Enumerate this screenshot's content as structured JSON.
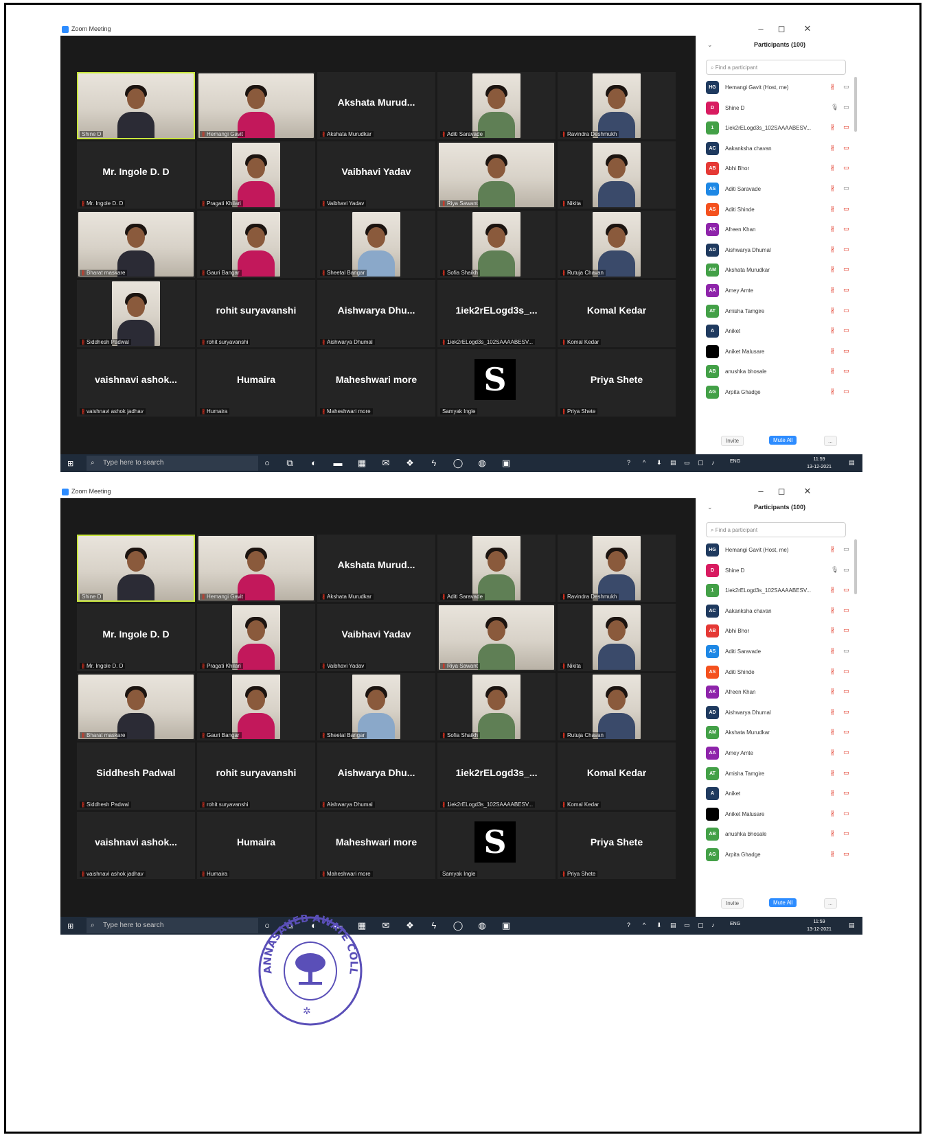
{
  "window_title": "Zoom Meeting",
  "panel": {
    "title": "Participants (100)",
    "search_placeholder": "Find a participant",
    "invite_label": "Invite",
    "mute_all_label": "Mute All",
    "more_label": "..."
  },
  "taskbar": {
    "search_placeholder": "Type here to search",
    "lang": "ENG",
    "time": "11:59",
    "date": "13-12-2021"
  },
  "screens": [
    {
      "tiles": [
        {
          "caption": "Shine D",
          "big": "",
          "photo": "wide",
          "mic": false,
          "active": true
        },
        {
          "caption": "Hemangi Gavit",
          "big": "",
          "photo": "wide",
          "mic": true
        },
        {
          "caption": "Akshata Murudkar",
          "big": "Akshata Murud...",
          "mic": true
        },
        {
          "caption": "Aditi Saravade",
          "big": "",
          "photo": "narrow",
          "mic": true
        },
        {
          "caption": "Ravindra Deshmukh",
          "big": "",
          "photo": "narrow",
          "mic": true
        },
        {
          "caption": "Mr. Ingole D. D",
          "big": "Mr. Ingole D. D",
          "mic": true
        },
        {
          "caption": "Pragati Khilari",
          "big": "",
          "photo": "narrow",
          "mic": true
        },
        {
          "caption": "Vaibhavi Yadav",
          "big": "Vaibhavi Yadav",
          "mic": true
        },
        {
          "caption": "Riya Sawant",
          "big": "",
          "photo": "wide",
          "mic": true
        },
        {
          "caption": "Nikita",
          "big": "",
          "photo": "narrow",
          "mic": true
        },
        {
          "caption": "Bharat maskare",
          "big": "",
          "photo": "wide",
          "mic": true
        },
        {
          "caption": "Gauri Bangar",
          "big": "",
          "photo": "narrow",
          "mic": true
        },
        {
          "caption": "Sheetal Bangar",
          "big": "",
          "photo": "narrow",
          "mic": true
        },
        {
          "caption": "Sofia Shaikh",
          "big": "",
          "photo": "narrow",
          "mic": true
        },
        {
          "caption": "Rutuja Chavan",
          "big": "",
          "photo": "narrow",
          "mic": true
        },
        {
          "caption": "Siddhesh Padwal",
          "big": "",
          "photo": "narrow",
          "mic": true
        },
        {
          "caption": "rohit suryavanshi",
          "big": "rohit suryavanshi",
          "mic": true
        },
        {
          "caption": "Aishwarya Dhumal",
          "big": "Aishwarya  Dhu...",
          "mic": true
        },
        {
          "caption": "1iek2rELogd3s_102SAAAABESV...",
          "big": "1iek2rELogd3s_...",
          "mic": true
        },
        {
          "caption": "Komal Kedar",
          "big": "Komal Kedar",
          "mic": true
        },
        {
          "caption": "vaishnavi ashok jadhav",
          "big": "vaishnavi  ashok...",
          "mic": true
        },
        {
          "caption": "Humaira",
          "big": "Humaira",
          "mic": true
        },
        {
          "caption": "Maheshwari more",
          "big": "Maheshwari more",
          "mic": true
        },
        {
          "caption": "Samyak Ingle",
          "big": "",
          "logo": "S",
          "mic": false
        },
        {
          "caption": "Priya Shete",
          "big": "Priya Shete",
          "mic": true
        }
      ]
    },
    {
      "tiles": [
        {
          "caption": "Shine D",
          "big": "",
          "photo": "wide",
          "mic": false,
          "active": true
        },
        {
          "caption": "Hemangi Gavit",
          "big": "",
          "photo": "wide",
          "mic": true
        },
        {
          "caption": "Akshata Murudkar",
          "big": "Akshata Murud...",
          "mic": true
        },
        {
          "caption": "Aditi Saravade",
          "big": "",
          "photo": "narrow",
          "mic": true
        },
        {
          "caption": "Ravindra Deshmukh",
          "big": "",
          "photo": "narrow",
          "mic": true
        },
        {
          "caption": "Mr. Ingole D. D",
          "big": "Mr. Ingole D. D",
          "mic": true
        },
        {
          "caption": "Pragati Khilari",
          "big": "",
          "photo": "narrow",
          "mic": true
        },
        {
          "caption": "Vaibhavi Yadav",
          "big": "Vaibhavi Yadav",
          "mic": true
        },
        {
          "caption": "Riya Sawant",
          "big": "",
          "photo": "wide",
          "mic": true
        },
        {
          "caption": "Nikita",
          "big": "",
          "photo": "narrow",
          "mic": true
        },
        {
          "caption": "Bharat maskare",
          "big": "",
          "photo": "wide",
          "mic": true
        },
        {
          "caption": "Gauri Bangar",
          "big": "",
          "photo": "narrow",
          "mic": true
        },
        {
          "caption": "Sheetal Bangar",
          "big": "",
          "photo": "narrow",
          "mic": true
        },
        {
          "caption": "Sofia Shaikh",
          "big": "",
          "photo": "narrow",
          "mic": true
        },
        {
          "caption": "Rutuja Chavan",
          "big": "",
          "photo": "narrow",
          "mic": true
        },
        {
          "caption": "Siddhesh Padwal",
          "big": "Siddhesh Padwal",
          "mic": true
        },
        {
          "caption": "rohit suryavanshi",
          "big": "rohit suryavanshi",
          "mic": true
        },
        {
          "caption": "Aishwarya Dhumal",
          "big": "Aishwarya  Dhu...",
          "mic": true
        },
        {
          "caption": "1iek2rELogd3s_102SAAAABESV...",
          "big": "1iek2rELogd3s_...",
          "mic": true
        },
        {
          "caption": "Komal Kedar",
          "big": "Komal Kedar",
          "mic": true
        },
        {
          "caption": "vaishnavi ashok jadhav",
          "big": "vaishnavi  ashok...",
          "mic": true
        },
        {
          "caption": "Humaira",
          "big": "Humaira",
          "mic": true
        },
        {
          "caption": "Maheshwari more",
          "big": "Maheshwari more",
          "mic": true
        },
        {
          "caption": "Samyak Ingle",
          "big": "",
          "logo": "S",
          "mic": false
        },
        {
          "caption": "Priya Shete",
          "big": "Priya Shete",
          "mic": true
        }
      ]
    }
  ],
  "participants": [
    {
      "initials": "HG",
      "name": "Hemangi Gavit (Host, me)",
      "color": "#1f3a5f",
      "mic_on": false,
      "cam_on": true
    },
    {
      "initials": "D",
      "name": "Shine D",
      "color": "#d81b60",
      "mic_on": true,
      "cam_on": true
    },
    {
      "initials": "1",
      "name": "1iek2rELogd3s_102SAAAABESV...",
      "color": "#43a047",
      "mic_on": false,
      "cam_on": false
    },
    {
      "initials": "AC",
      "name": "Aakanksha chavan",
      "color": "#1f3a5f",
      "mic_on": false,
      "cam_on": false
    },
    {
      "initials": "AB",
      "name": "Abhi Bhor",
      "color": "#e53935",
      "mic_on": false,
      "cam_on": false
    },
    {
      "initials": "AS",
      "name": "Aditi Saravade",
      "color": "#1e88e5",
      "mic_on": false,
      "cam_on": true
    },
    {
      "initials": "AS",
      "name": "Aditi Shinde",
      "color": "#f4511e",
      "mic_on": false,
      "cam_on": false
    },
    {
      "initials": "AK",
      "name": "Afreen Khan",
      "color": "#8e24aa",
      "mic_on": false,
      "cam_on": false
    },
    {
      "initials": "AD",
      "name": "Aishwarya Dhumal",
      "color": "#1f3a5f",
      "mic_on": false,
      "cam_on": false
    },
    {
      "initials": "AM",
      "name": "Akshata Murudkar",
      "color": "#43a047",
      "mic_on": false,
      "cam_on": false
    },
    {
      "initials": "AA",
      "name": "Amey Amte",
      "color": "#8e24aa",
      "mic_on": false,
      "cam_on": false
    },
    {
      "initials": "AT",
      "name": "Amisha Tamgire",
      "color": "#43a047",
      "mic_on": false,
      "cam_on": false
    },
    {
      "initials": "A",
      "name": "Aniket",
      "color": "#1f3a5f",
      "mic_on": false,
      "cam_on": false
    },
    {
      "initials": "",
      "name": "Aniket Malusare",
      "color": "#000000",
      "mic_on": false,
      "cam_on": false
    },
    {
      "initials": "AB",
      "name": "anushka bhosale",
      "color": "#43a047",
      "mic_on": false,
      "cam_on": false
    },
    {
      "initials": "AG",
      "name": "Arpita Ghadge",
      "color": "#43a047",
      "mic_on": false,
      "cam_on": false
    }
  ],
  "seal_text": "ANNASAHEB AWATE COLLEGE, MANCHAR"
}
